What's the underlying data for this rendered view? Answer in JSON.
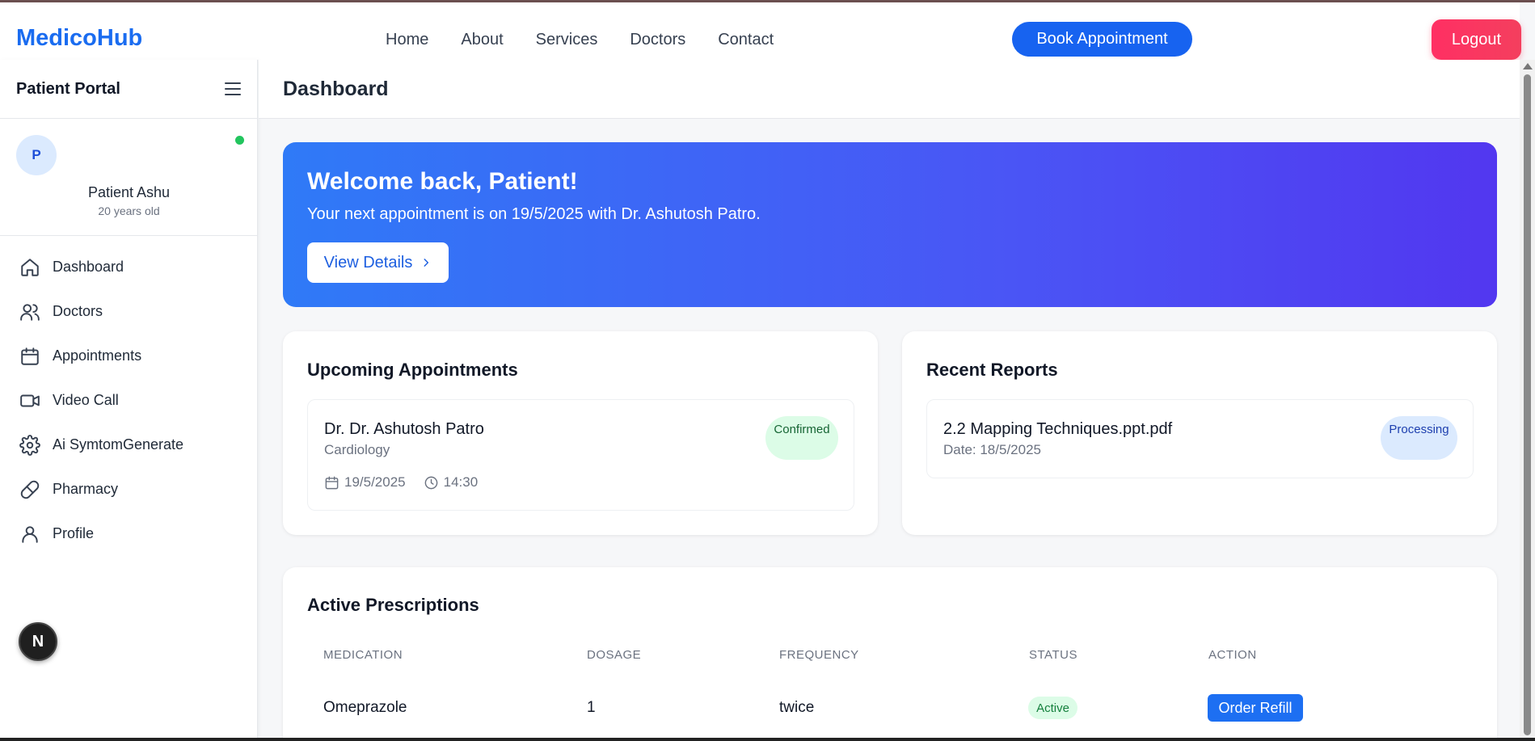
{
  "header": {
    "brand": "MedicoHub",
    "nav": [
      "Home",
      "About",
      "Services",
      "Doctors",
      "Contact"
    ],
    "book_label": "Book Appointment",
    "logout_label": "Logout"
  },
  "sidebar": {
    "title": "Patient Portal",
    "avatar_initial": "P",
    "patient_name": "Patient Ashu",
    "patient_age": "20 years old",
    "items": [
      {
        "label": "Dashboard",
        "icon": "home-icon"
      },
      {
        "label": "Doctors",
        "icon": "users-icon"
      },
      {
        "label": "Appointments",
        "icon": "calendar-icon"
      },
      {
        "label": "Video Call",
        "icon": "video-icon"
      },
      {
        "label": "Ai SymtomGenerate",
        "icon": "gear-icon"
      },
      {
        "label": "Pharmacy",
        "icon": "pill-icon"
      },
      {
        "label": "Profile",
        "icon": "user-icon"
      }
    ],
    "floating_badge": "N"
  },
  "main": {
    "title": "Dashboard",
    "welcome": {
      "title": "Welcome back, Patient!",
      "subtitle": "Your next appointment is on 19/5/2025 with Dr. Ashutosh Patro.",
      "button": "View Details"
    },
    "appointments": {
      "title": "Upcoming Appointments",
      "doctor": "Dr. Dr. Ashutosh Patro",
      "specialty": "Cardiology",
      "status": "Confirmed",
      "date": "19/5/2025",
      "time": "14:30"
    },
    "reports": {
      "title": "Recent Reports",
      "file": "2.2 Mapping Techniques.ppt.pdf",
      "date": "Date: 18/5/2025",
      "status": "Processing"
    },
    "prescriptions": {
      "title": "Active Prescriptions",
      "columns": [
        "MEDICATION",
        "DOSAGE",
        "FREQUENCY",
        "STATUS",
        "ACTION"
      ],
      "rows": [
        {
          "medication": "Omeprazole",
          "dosage": "1",
          "frequency": "twice",
          "status": "Active",
          "action": "Order Refill"
        }
      ]
    }
  },
  "colors": {
    "brand": "#1a6cf0",
    "primary": "#1763f0",
    "logout": "#f43f5e",
    "online": "#22c55e"
  }
}
